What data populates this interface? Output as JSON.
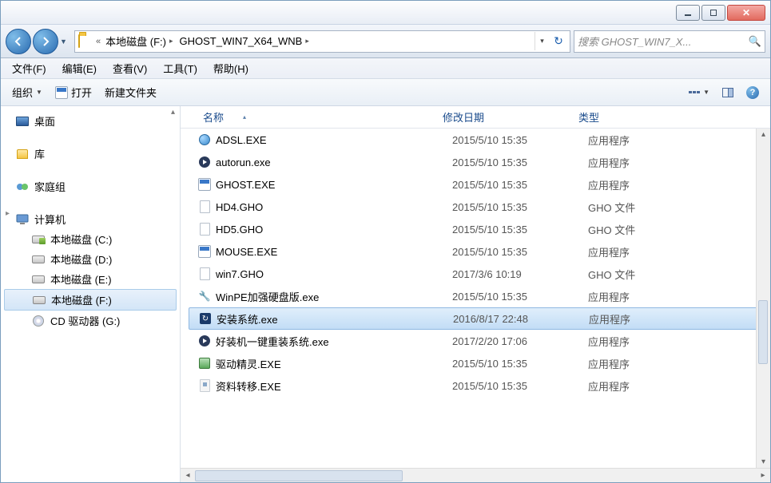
{
  "breadcrumb": {
    "prefix": "«",
    "seg1": "本地磁盘 (F:)",
    "seg2": "GHOST_WIN7_X64_WNB"
  },
  "search": {
    "placeholder": "搜索 GHOST_WIN7_X..."
  },
  "menu": {
    "file": "文件(F)",
    "edit": "编辑(E)",
    "view": "查看(V)",
    "tools": "工具(T)",
    "help": "帮助(H)"
  },
  "toolbar": {
    "organize": "组织",
    "open": "打开",
    "newfolder": "新建文件夹"
  },
  "tree": {
    "desktop": "桌面",
    "libraries": "库",
    "homegroup": "家庭组",
    "computer": "计算机",
    "drive_c": "本地磁盘 (C:)",
    "drive_d": "本地磁盘 (D:)",
    "drive_e": "本地磁盘 (E:)",
    "drive_f": "本地磁盘 (F:)",
    "drive_g": "CD 驱动器 (G:)"
  },
  "cols": {
    "name": "名称",
    "date": "修改日期",
    "type": "类型"
  },
  "files": [
    {
      "icon": "globe",
      "name": "ADSL.EXE",
      "date": "2015/5/10 15:35",
      "type": "应用程序"
    },
    {
      "icon": "play",
      "name": "autorun.exe",
      "date": "2015/5/10 15:35",
      "type": "应用程序"
    },
    {
      "icon": "app",
      "name": "GHOST.EXE",
      "date": "2015/5/10 15:35",
      "type": "应用程序"
    },
    {
      "icon": "blank",
      "name": "HD4.GHO",
      "date": "2015/5/10 15:35",
      "type": "GHO 文件"
    },
    {
      "icon": "blank",
      "name": "HD5.GHO",
      "date": "2015/5/10 15:35",
      "type": "GHO 文件"
    },
    {
      "icon": "app",
      "name": "MOUSE.EXE",
      "date": "2015/5/10 15:35",
      "type": "应用程序"
    },
    {
      "icon": "blank",
      "name": "win7.GHO",
      "date": "2017/3/6 10:19",
      "type": "GHO 文件"
    },
    {
      "icon": "pe",
      "name": "WinPE加强硬盘版.exe",
      "date": "2015/5/10 15:35",
      "type": "应用程序"
    },
    {
      "icon": "installer",
      "name": "安装系统.exe",
      "date": "2016/8/17 22:48",
      "type": "应用程序",
      "selected": true
    },
    {
      "icon": "play",
      "name": "好装机一键重装系统.exe",
      "date": "2017/2/20 17:06",
      "type": "应用程序"
    },
    {
      "icon": "tool",
      "name": "驱动精灵.EXE",
      "date": "2015/5/10 15:35",
      "type": "应用程序"
    },
    {
      "icon": "page",
      "name": "资料转移.EXE",
      "date": "2015/5/10 15:35",
      "type": "应用程序"
    }
  ]
}
